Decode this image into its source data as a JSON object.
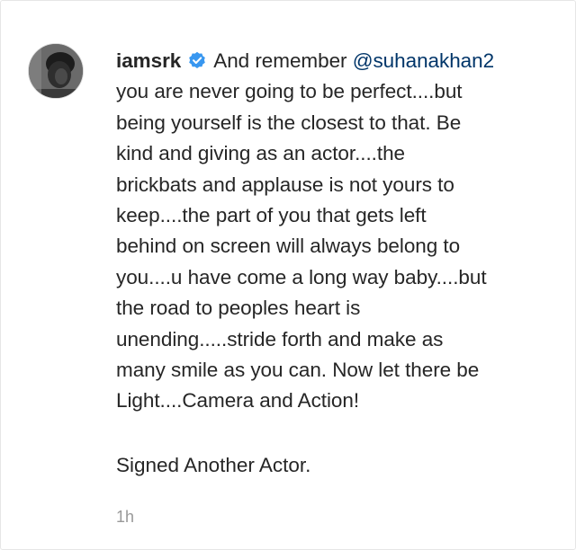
{
  "comment": {
    "username": "iamsrk",
    "verified_icon": "verified-badge-icon",
    "lead_text": "And remember",
    "mention": "@suhanakhan2",
    "body_text": "you are never going to be perfect....but\nbeing yourself is the closest to that. Be\nkind and giving as an actor....the\nbrickbats and applause is not yours to\nkeep....the part of you that gets left\nbehind on screen will always belong to\nyou....u have come a long way baby....but\nthe road to peoples heart is\nunending.....stride forth and make as\nmany smile as you can. Now let there be\nLight....Camera and Action!",
    "signature": "Signed Another Actor.",
    "timestamp": "1h"
  },
  "colors": {
    "text": "#262626",
    "mention": "#003569",
    "verified": "#3897f0",
    "timestamp": "#999999"
  }
}
